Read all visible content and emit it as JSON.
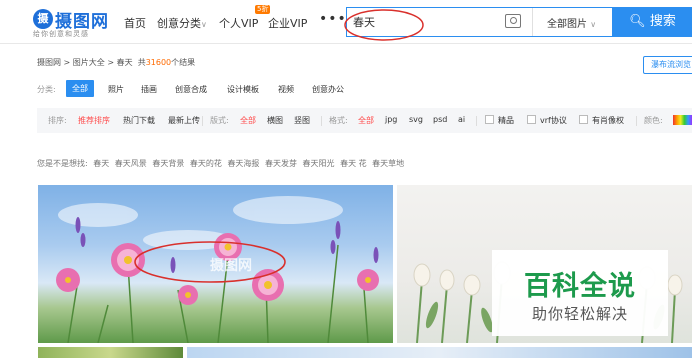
{
  "header": {
    "logo_text": "摄图网",
    "logo_slogan": "给你创意和灵感",
    "nav": [
      {
        "label": "首页"
      },
      {
        "label": "创意分类"
      },
      {
        "label": "个人VIP"
      },
      {
        "label": "企业VIP"
      }
    ],
    "vip_badge": "5折",
    "more": "•••",
    "search": {
      "value": "春天",
      "scope": "全部图片",
      "button": "搜索"
    }
  },
  "breadcrumb": {
    "path": [
      "摄图网",
      "图片大全",
      "春天"
    ],
    "result_prefix": "共",
    "result_count": "31600",
    "result_suffix": "个结果"
  },
  "view_toggle": "瀑布流浏览",
  "categories": {
    "label": "分类:",
    "items": [
      "全部",
      "照片",
      "插画",
      "创意合成",
      "设计模板",
      "视频",
      "创意办公"
    ],
    "active_index": 0
  },
  "filters": {
    "sort_label": "排序:",
    "sort_items": [
      "推荐排序",
      "热门下载",
      "最新上传"
    ],
    "layout_label": "版式:",
    "layout_items": [
      "全部",
      "横图",
      "竖图"
    ],
    "format_label": "格式:",
    "format_items": [
      "全部",
      "jpg",
      "svg",
      "psd",
      "ai"
    ],
    "checks": [
      "精品",
      "vrf协议",
      "有肖像权"
    ],
    "color_label": "颜色:"
  },
  "suggestions": {
    "label": "您是不是想找:",
    "items": [
      "春天",
      "春天风景",
      "春天背景",
      "春天的花",
      "春天海报",
      "春天发芽",
      "春天阳光",
      "春天 花",
      "春天草地"
    ]
  },
  "images": {
    "watermark": "摄图网"
  },
  "overlay": {
    "title": "百科全说",
    "subtitle": "助你轻松解决"
  },
  "colors": {
    "accent": "#2b8ef0",
    "highlight": "#ff4b4b",
    "annotation": "#d9302c",
    "overlay_green": "#1d9a4c"
  }
}
